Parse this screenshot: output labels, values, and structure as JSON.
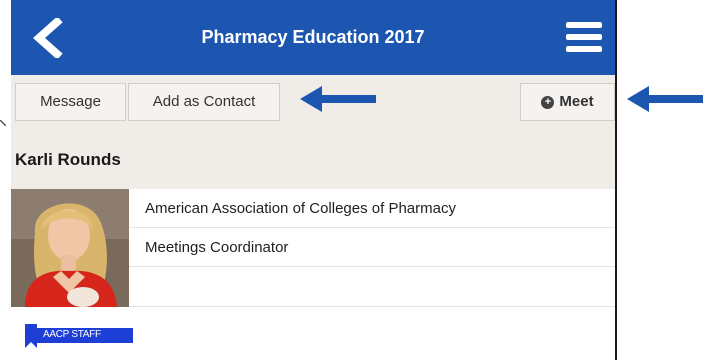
{
  "header": {
    "title": "Pharmacy Education 2017",
    "color": "#1d56b1",
    "back_icon": "chevron-left-icon",
    "menu_icon": "hamburger-menu-icon"
  },
  "toolbar": {
    "message_label": "Message",
    "add_contact_label": "Add as Contact",
    "meet_label": "Meet",
    "meet_icon": "plus-circle-icon"
  },
  "profile": {
    "name": "Karli Rounds",
    "organization": "American Association of Colleges of Pharmacy",
    "title": "Meetings Coordinator",
    "badge_label": "AACP STAFF",
    "badge_color": "#1d3fd6"
  },
  "annotations": {
    "arrow_color": "#1d56b1"
  }
}
